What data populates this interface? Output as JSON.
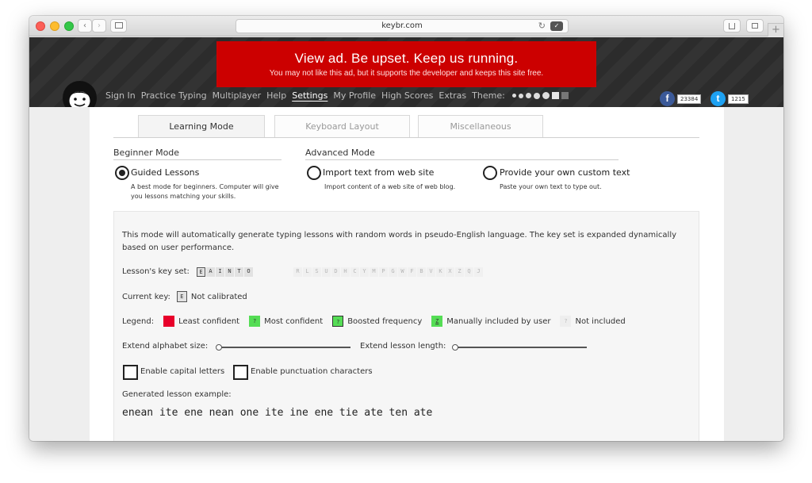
{
  "browser": {
    "url": "keybr.com",
    "reload_glyph": "↻",
    "pocket_glyph": "✓",
    "newtab_glyph": "+"
  },
  "ad": {
    "title": "View ad. Be upset. Keep us running.",
    "subtitle": "You may not like this ad, but it supports the developer and keeps this site free."
  },
  "nav": {
    "items": [
      "Sign In",
      "Practice Typing",
      "Multiplayer",
      "Help",
      "Settings",
      "My Profile",
      "High Scores",
      "Extras"
    ],
    "active": "Settings",
    "theme_label": "Theme:"
  },
  "social": {
    "facebook_glyph": "f",
    "facebook_count": "23384",
    "twitter_glyph": "t",
    "twitter_count": "1215"
  },
  "tabs": [
    "Learning Mode",
    "Keyboard Layout",
    "Miscellaneous"
  ],
  "modes": {
    "beginner_title": "Beginner Mode",
    "advanced_title": "Advanced Mode",
    "guided": {
      "label": "Guided Lessons",
      "desc1": "A best mode for beginners. Computer will give",
      "desc2": "you lessons matching your skills."
    },
    "import": {
      "label": "Import text from web site",
      "desc": "Import content of a web site of web blog."
    },
    "custom": {
      "label": "Provide your own custom text",
      "desc": "Paste your own text to type out."
    }
  },
  "panel": {
    "intro": "This mode will automatically generate typing lessons with random words in pseudo-English language. The key set is expanded dynamically based on user performance.",
    "keyset_label": "Lesson's key set:",
    "included_keys": [
      "E",
      "A",
      "I",
      "N",
      "T",
      "O"
    ],
    "excluded_keys": [
      "R",
      "L",
      "S",
      "U",
      "D",
      "H",
      "C",
      "Y",
      "M",
      "P",
      "G",
      "W",
      "F",
      "B",
      "V",
      "K",
      "X",
      "Z",
      "Q",
      "J"
    ],
    "current_key_label": "Current key:",
    "current_key": "E",
    "current_key_status": "Not calibrated",
    "legend_label": "Legend:",
    "legend": [
      {
        "glyph": "?",
        "label": "Least confident",
        "color": "#e8002a"
      },
      {
        "glyph": "?",
        "label": "Most confident",
        "color": "#55dd55"
      },
      {
        "glyph": "?",
        "label": "Boosted frequency",
        "color": "#55dd55"
      },
      {
        "glyph": "Z",
        "label": "Manually included by user",
        "color": "#55dd55"
      },
      {
        "glyph": "?",
        "label": "Not included",
        "color": "#eeeeee"
      }
    ],
    "extend_alphabet_label": "Extend alphabet size:",
    "extend_length_label": "Extend lesson length:",
    "capital_label": "Enable capital letters",
    "punctuation_label": "Enable punctuation characters",
    "example_label": "Generated lesson example:",
    "example_text": "enean ite ene nean one ite ine ene tie ate ten ate"
  }
}
